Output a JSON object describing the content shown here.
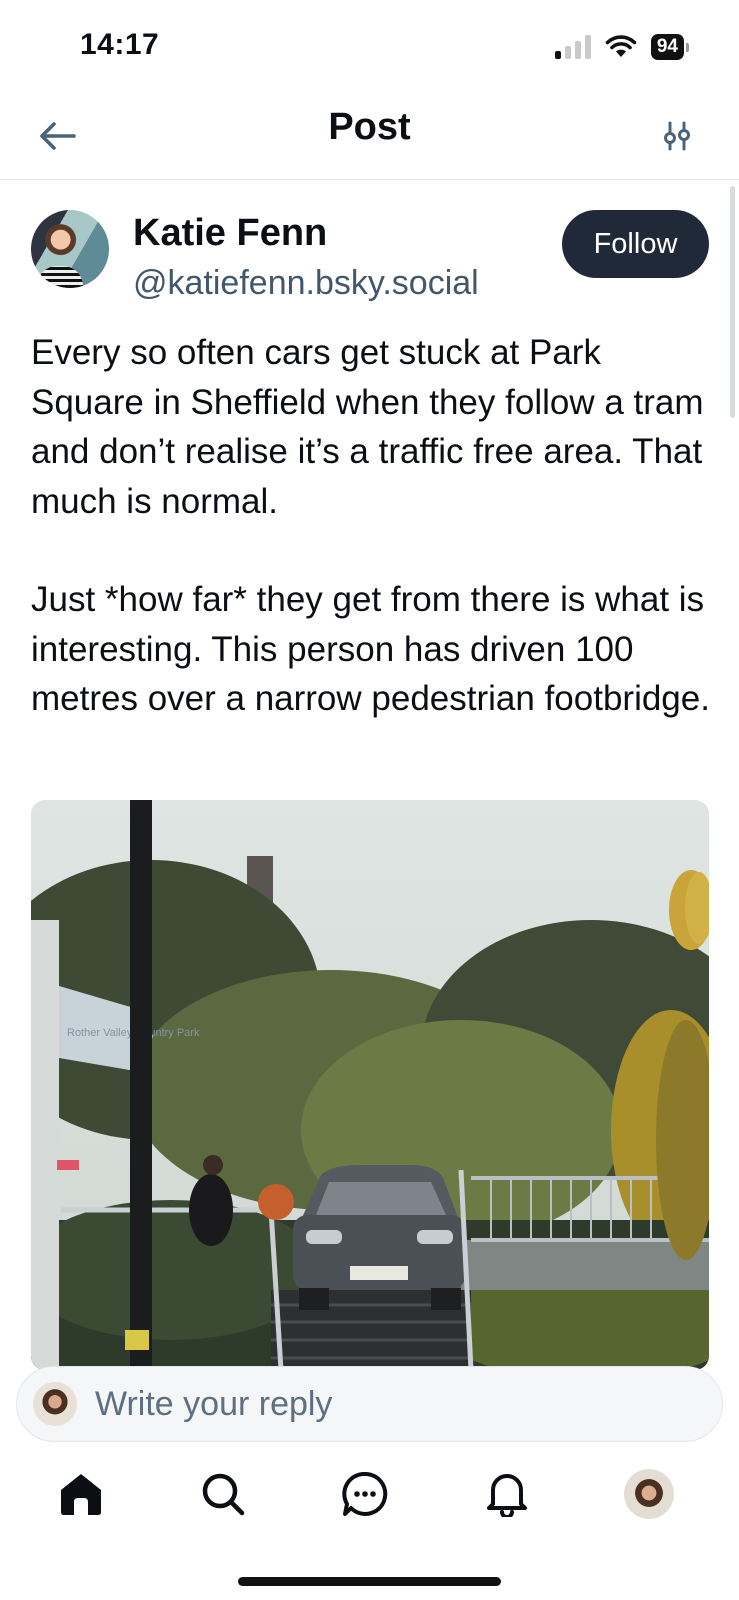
{
  "status_bar": {
    "time": "14:17",
    "battery": "94"
  },
  "header": {
    "title": "Post",
    "back_icon": "arrow-left-icon",
    "filter_icon": "sliders-icon"
  },
  "post": {
    "author": {
      "name": "Katie Fenn",
      "handle": "@katiefenn.bsky.social"
    },
    "follow_label": "Follow",
    "text": {
      "paragraph_1": "Every so often cars get stuck at Park Square in Sheffield when they follow a tram and don’t realise it’s a traffic free area. That much is normal.",
      "paragraph_2": "Just *how far* they get from there is what is interesting. This person has driven 100 metres over a narrow pedestrian footbridge."
    },
    "image": {
      "sign_text": "Rother Valley Country Park",
      "plate_text": "CK57 YEE"
    }
  },
  "reply": {
    "placeholder": "Write your reply"
  },
  "tab_bar": {
    "items": [
      "home-icon",
      "search-icon",
      "chat-icon",
      "bell-icon",
      "profile-avatar"
    ]
  },
  "colors": {
    "follow_button": "#1f2937",
    "handle_text": "#42576c",
    "reply_background": "#f4f6f8"
  }
}
